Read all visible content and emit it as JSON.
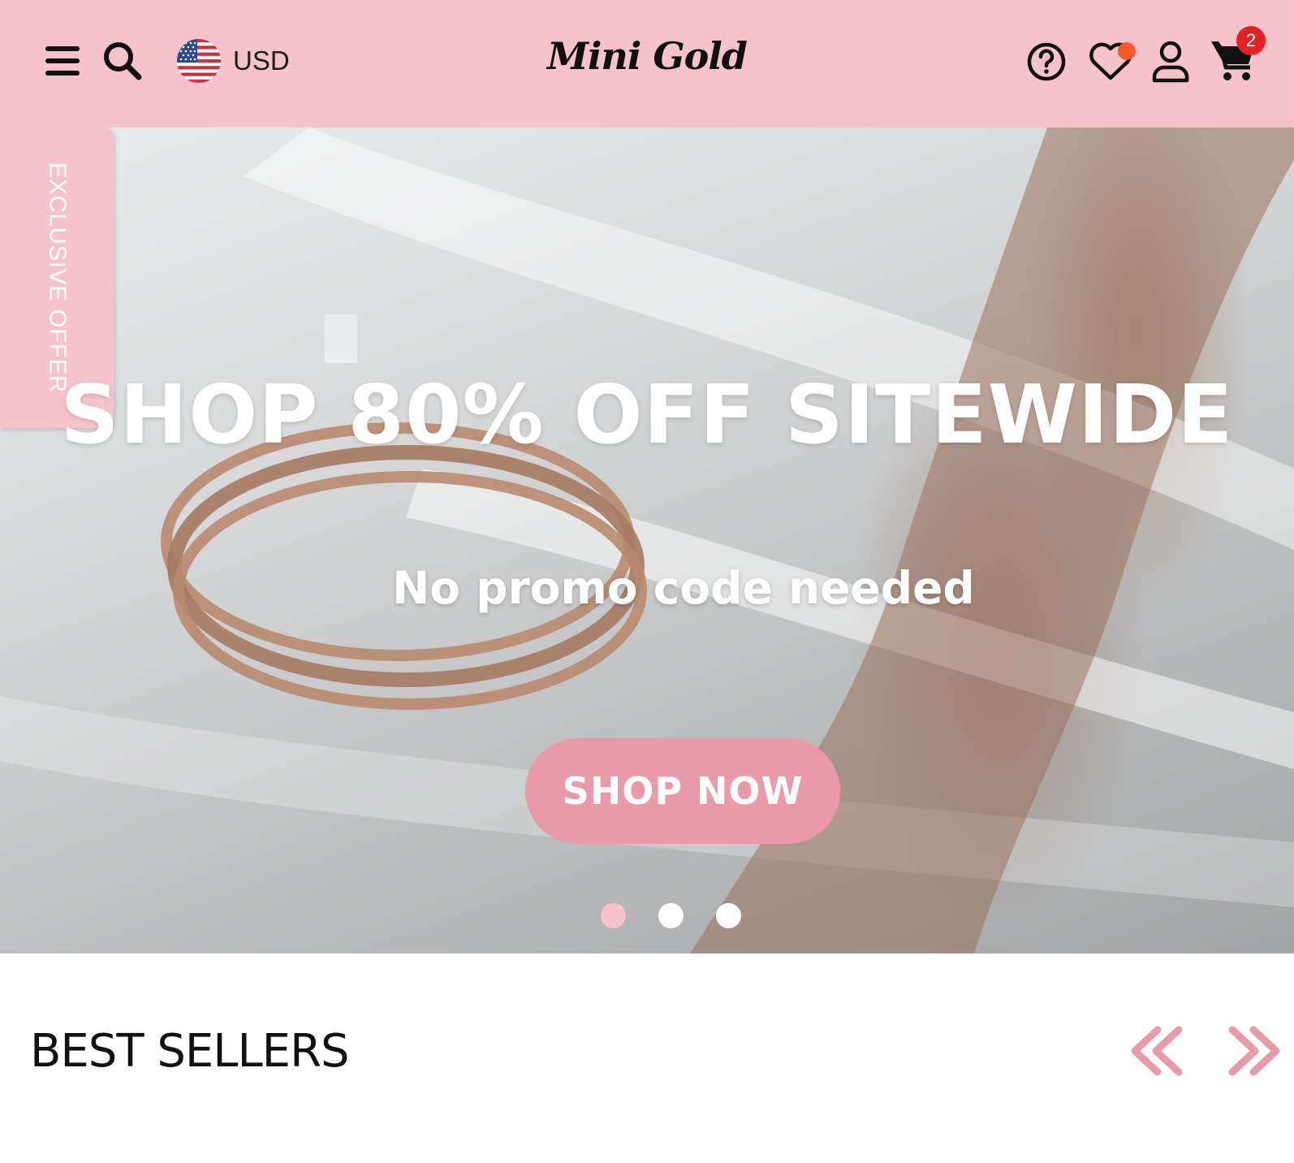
{
  "header": {
    "currency": "USD",
    "logo": "Mini Gold",
    "cart_count": "2",
    "bg_color": "#f6c3cd"
  },
  "hero": {
    "offer_tab": "EXCLUSIVE OFFER",
    "headline": "SHOP 80% OFF SITEWIDE",
    "subline": "No promo code needed",
    "cta": "SHOP NOW",
    "slides": 3,
    "active_slide": 1,
    "accent_color": "#e89aaa"
  },
  "best_sellers": {
    "title": "BEST SELLERS"
  },
  "icons": [
    "menu-icon",
    "search-icon",
    "us-flag-icon",
    "help-icon",
    "heart-icon",
    "user-icon",
    "cart-icon",
    "chevron-double-left-icon",
    "chevron-double-right-icon"
  ]
}
